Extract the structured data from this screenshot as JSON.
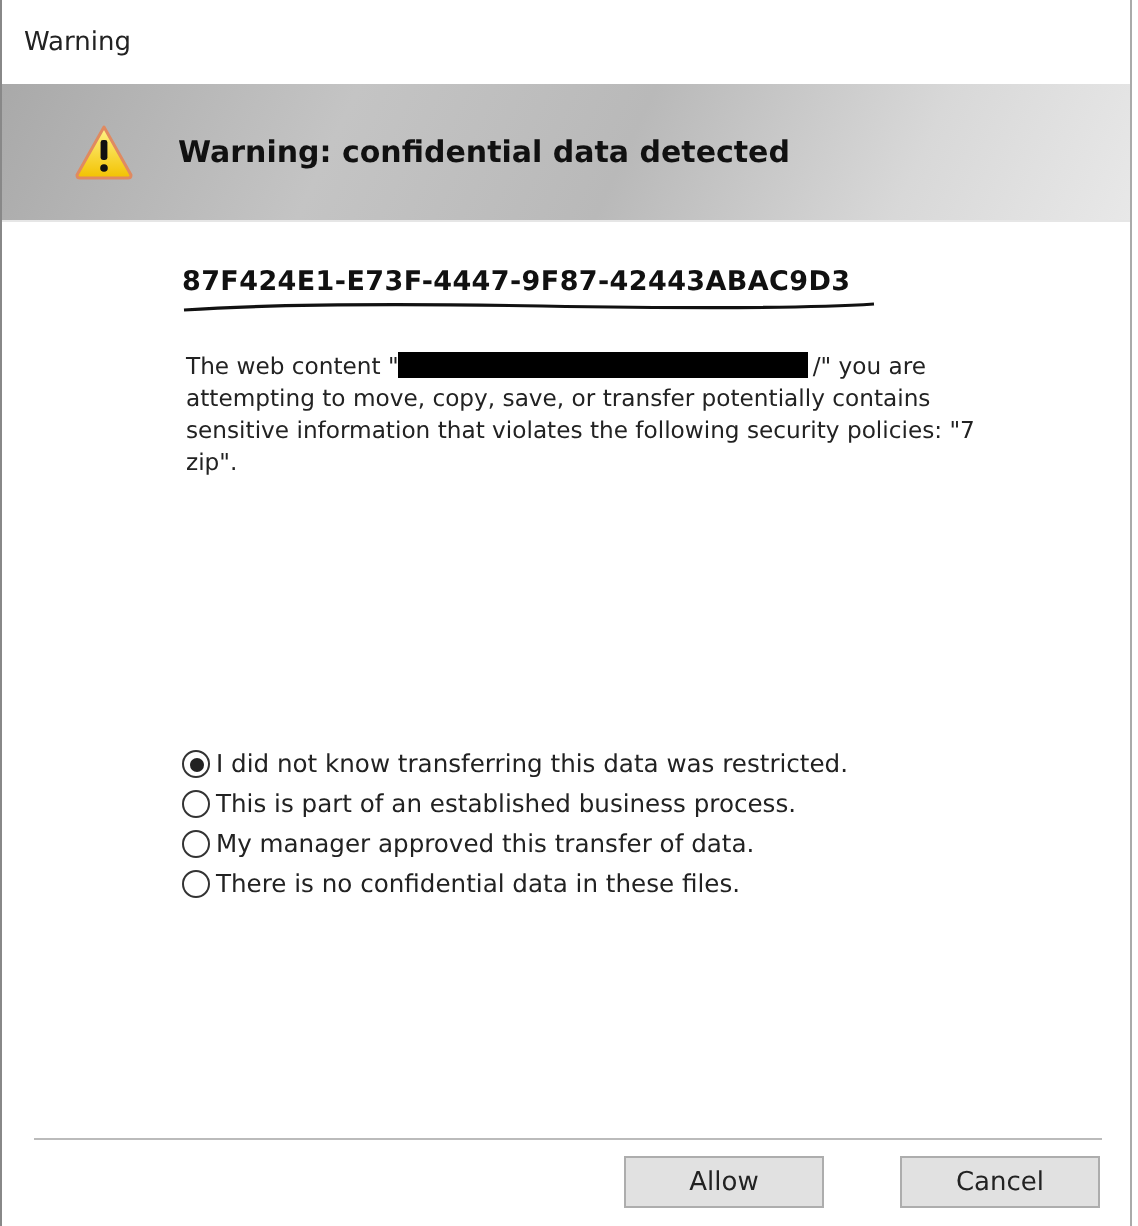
{
  "window": {
    "title": "Warning"
  },
  "header": {
    "title": "Warning: confidential data detected"
  },
  "identifier": "87F424E1-E73F-4447-9F87-42443ABAC9D3",
  "message": {
    "before_redaction": "The web content \"",
    "after_redaction": "/\" you are attempting to move, copy, save, or transfer potentially contains sensitive information that violates the following security policies: \"7 zip\"."
  },
  "reasons": [
    {
      "label": "I did not know transferring this data was restricted.",
      "selected": true
    },
    {
      "label": "This is part of an established business process.",
      "selected": false
    },
    {
      "label": "My manager approved this transfer of data.",
      "selected": false
    },
    {
      "label": "There is no confidential data in these files.",
      "selected": false
    }
  ],
  "buttons": [
    "Allow",
    "Cancel"
  ]
}
